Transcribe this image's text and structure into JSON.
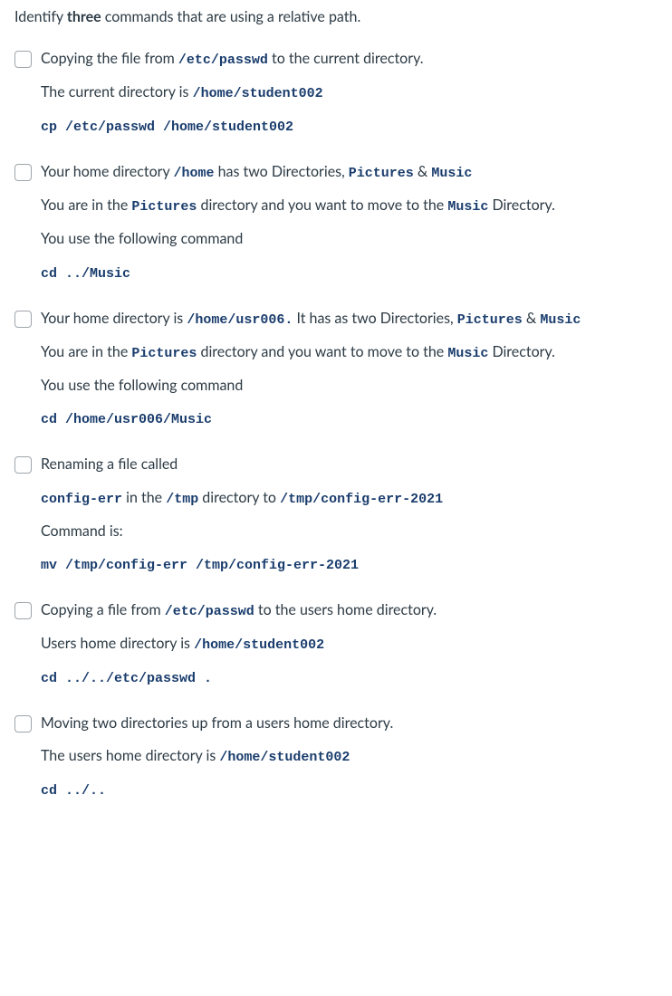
{
  "question": {
    "pre": "Identify ",
    "bold": "three",
    "post": " commands that are using a relative path."
  },
  "options": [
    {
      "lines": [
        {
          "parts": [
            {
              "t": "Copying the file from "
            },
            {
              "t": "/etc/passwd",
              "mono": true
            },
            {
              "t": " to the current directory."
            }
          ]
        },
        {
          "parts": [
            {
              "t": "The current directory is "
            },
            {
              "t": "/home/student002",
              "mono": true
            }
          ]
        },
        {
          "parts": [
            {
              "t": "cp /etc/passwd /home/student002",
              "mono": true
            }
          ],
          "cmd": true
        }
      ]
    },
    {
      "lines": [
        {
          "parts": [
            {
              "t": "Your home directory "
            },
            {
              "t": "/home",
              "mono": true
            },
            {
              "t": "  has two Directories, "
            },
            {
              "t": "Pictures",
              "mono": true
            },
            {
              "t": " & "
            },
            {
              "t": "Music",
              "mono": true
            }
          ]
        },
        {
          "parts": [
            {
              "t": "You are in the "
            },
            {
              "t": "Pictures",
              "mono": true
            },
            {
              "t": "  directory and you want to move to the "
            },
            {
              "t": "Music",
              "mono": true
            },
            {
              "t": " Directory."
            }
          ]
        },
        {
          "parts": [
            {
              "t": "You use the following command"
            }
          ]
        },
        {
          "parts": [
            {
              "t": "cd ../Music",
              "mono": true
            }
          ],
          "cmd": true
        }
      ]
    },
    {
      "lines": [
        {
          "parts": [
            {
              "t": "Your home directory is "
            },
            {
              "t": "/home/usr006.",
              "mono": true
            },
            {
              "t": "  It has as two Directories, "
            },
            {
              "t": "Pictures",
              "mono": true
            },
            {
              "t": " & "
            },
            {
              "t": "Music",
              "mono": true
            }
          ]
        },
        {
          "parts": [
            {
              "t": "You are in the "
            },
            {
              "t": "Pictures",
              "mono": true
            },
            {
              "t": "  directory and you want to move to the "
            },
            {
              "t": "Music",
              "mono": true
            },
            {
              "t": " Directory."
            }
          ]
        },
        {
          "parts": [
            {
              "t": "You use the following command"
            }
          ]
        },
        {
          "parts": [
            {
              "t": "cd /home/usr006/Music",
              "mono": true
            }
          ],
          "cmd": true
        }
      ]
    },
    {
      "lines": [
        {
          "parts": [
            {
              "t": "Renaming a file called"
            }
          ]
        },
        {
          "parts": [
            {
              "t": "config-err",
              "mono": true
            },
            {
              "t": " in the "
            },
            {
              "t": "/tmp",
              "mono": true
            },
            {
              "t": " directory to  "
            },
            {
              "t": "/tmp/config-err-2021",
              "mono": true
            }
          ]
        },
        {
          "parts": [
            {
              "t": "Command is:"
            }
          ]
        },
        {
          "parts": [
            {
              "t": "mv /tmp/config-err /tmp/config-err-2021",
              "mono": true
            }
          ],
          "cmd": true
        }
      ]
    },
    {
      "lines": [
        {
          "parts": [
            {
              "t": "Copying a file from "
            },
            {
              "t": "/etc/passwd",
              "mono": true
            },
            {
              "t": " to the users home directory."
            }
          ]
        },
        {
          "parts": [
            {
              "t": "Users home directory is "
            },
            {
              "t": "/home/student002",
              "mono": true
            }
          ]
        },
        {
          "parts": [
            {
              "t": "cd ../../etc/passwd .",
              "mono": true
            }
          ],
          "cmd": true
        }
      ]
    },
    {
      "lines": [
        {
          "parts": [
            {
              "t": "Moving two directories up from a users home directory."
            }
          ]
        },
        {
          "parts": [
            {
              "t": "The users home directory is "
            },
            {
              "t": "/home/student002",
              "mono": true
            }
          ]
        },
        {
          "parts": [
            {
              "t": "cd ../..",
              "mono": true
            }
          ],
          "cmd": true
        }
      ]
    }
  ]
}
